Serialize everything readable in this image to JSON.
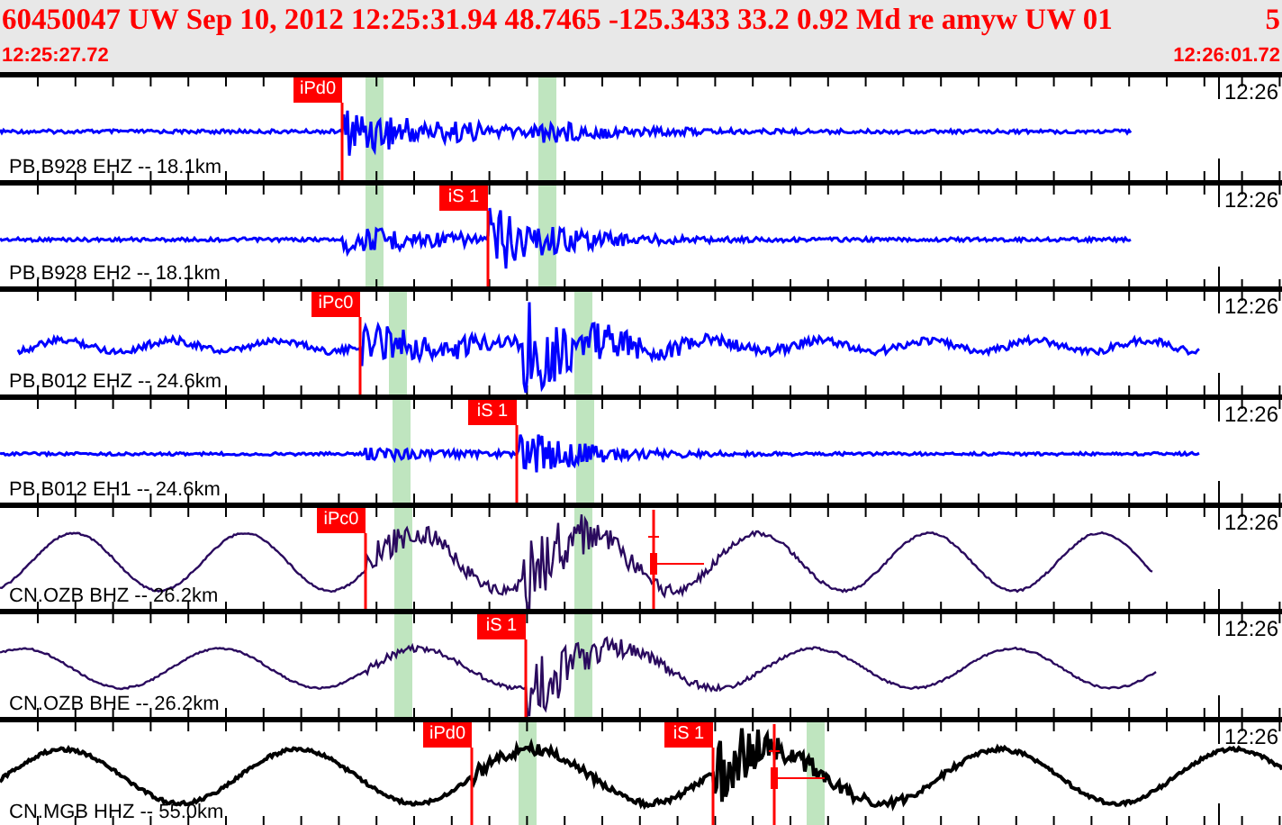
{
  "header": {
    "title": "60450047 UW Sep 10, 2012 12:25:31.94   48.7465 -125.3433 33.2 0.92 Md re amyw UW 01",
    "title_tail": "5",
    "start_time": "12:25:27.72",
    "end_time": "12:26:01.72"
  },
  "traces": [
    {
      "label": "PB.B928 EHZ -- 18.1km",
      "time": "12:26",
      "color": "#0000ff",
      "picks": [
        {
          "label": "iPd0"
        }
      ]
    },
    {
      "label": "PB.B928 EH2 -- 18.1km",
      "time": "12:26",
      "color": "#0000ff",
      "picks": [
        {
          "label": "iS 1"
        }
      ]
    },
    {
      "label": "PB.B012 EHZ -- 24.6km",
      "time": "12:26",
      "color": "#0000ff",
      "picks": [
        {
          "label": "iPc0"
        }
      ]
    },
    {
      "label": "PB.B012 EH1 -- 24.6km",
      "time": "12:26",
      "color": "#0000ff",
      "picks": [
        {
          "label": "iS 1"
        }
      ]
    },
    {
      "label": "CN.OZB BHZ -- 26.2km",
      "time": "12:26",
      "color": "#2a0a5e",
      "picks": [
        {
          "label": "iPc0"
        }
      ]
    },
    {
      "label": "CN.OZB BHE -- 26.2km",
      "time": "12:26",
      "color": "#2a0a5e",
      "picks": [
        {
          "label": "iS 1"
        }
      ]
    },
    {
      "label": "CN.MGB HHZ -- 55.0km",
      "time": "12:26",
      "color": "#000000",
      "picks": [
        {
          "label": "iPd0"
        },
        {
          "label": "iS 1"
        }
      ]
    }
  ]
}
